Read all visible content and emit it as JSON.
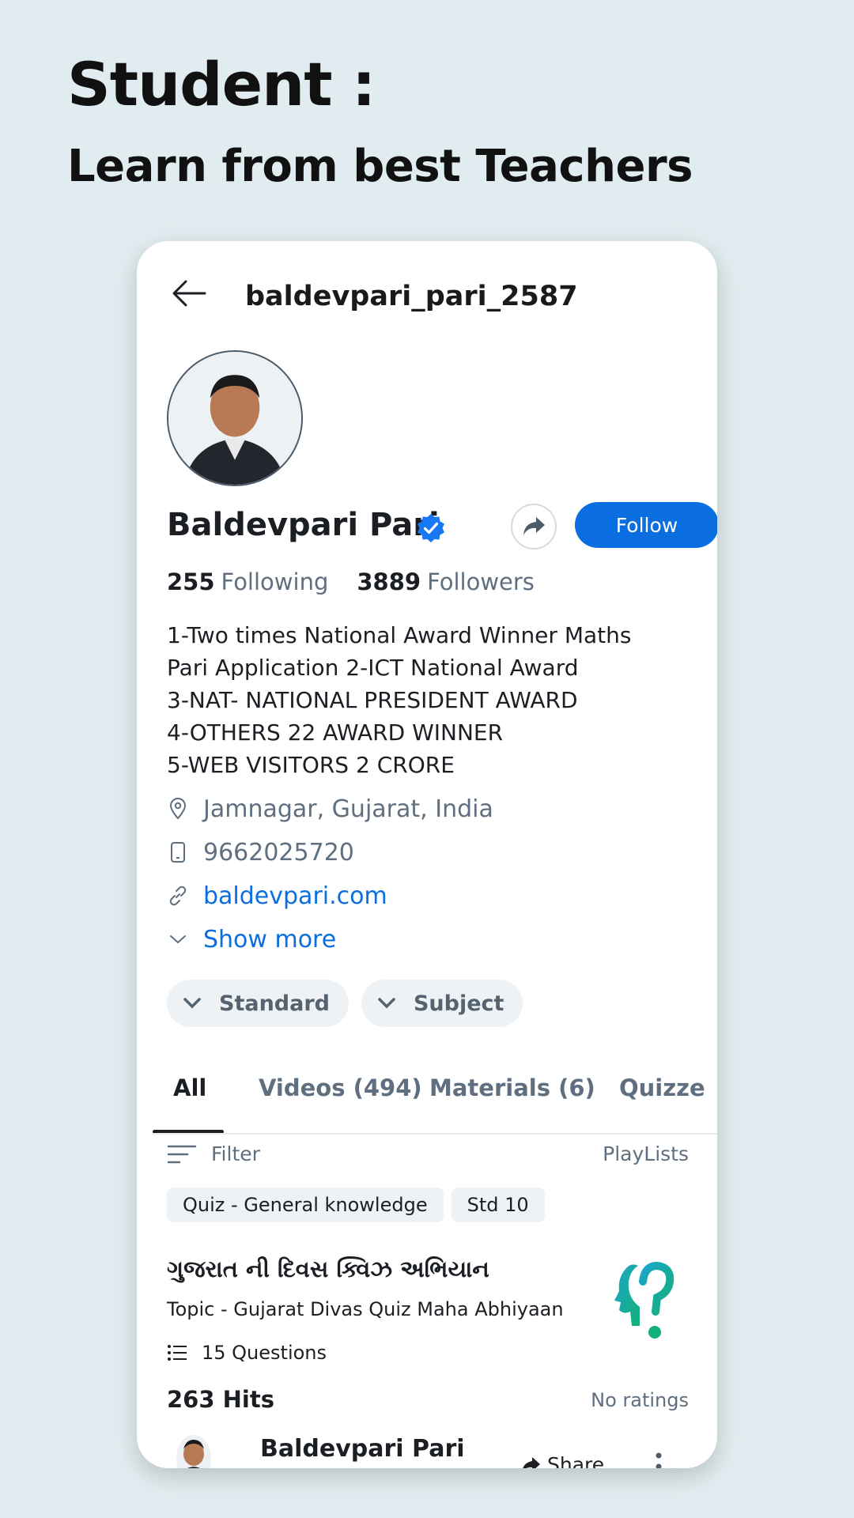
{
  "promo": {
    "headline": "Student :",
    "subheadline": "Learn from best Teachers"
  },
  "profile": {
    "username": "baldevpari_pari_2587",
    "display_name": "Baldevpari Pari",
    "follow_label": "Follow",
    "following_count": "255",
    "following_label": "Following",
    "followers_count": "3889",
    "followers_label": "Followers",
    "bio": [
      "1-Two times National Award Winner Maths",
      "Pari Application 2-ICT National Award",
      "3-NAT- NATIONAL PRESIDENT AWARD",
      "4-OTHERS 22 AWARD WINNER",
      "5-WEB VISITORS 2 CRORE"
    ],
    "location": "Jamnagar, Gujarat, India",
    "phone": "9662025720",
    "website": "baldevpari.com",
    "show_more": "Show more"
  },
  "filters": {
    "standard": "Standard",
    "subject": "Subject"
  },
  "tabs": [
    {
      "label": "All"
    },
    {
      "label": "Videos (494)"
    },
    {
      "label": "Materials (6)"
    },
    {
      "label": "Quizze"
    }
  ],
  "list": {
    "filter_label": "Filter",
    "playlists_label": "PlayLists"
  },
  "quiz": {
    "tags": [
      "Quiz - General knowledge",
      "Std 10"
    ],
    "title": "ગુજરાત ની દિવસ ક્વિઝ અભિયાન",
    "topic": "Topic - Gujarat Divas Quiz Maha Abhiyaan",
    "questions": "15 Questions",
    "hits": "263 Hits",
    "ratings": "No ratings",
    "author": "Baldevpari Pari",
    "share_label": "Share"
  },
  "colors": {
    "accent": "#0a6ee0",
    "background": "#e0ecef",
    "muted_text": "#5f6f80"
  },
  "icons": [
    "back-arrow-icon",
    "verified-badge-icon",
    "share-arrow-icon",
    "location-pin-icon",
    "phone-icon",
    "link-icon",
    "chevron-down-icon",
    "filter-lines-icon",
    "list-icon",
    "more-vertical-icon",
    "quiz-logo-icon"
  ]
}
